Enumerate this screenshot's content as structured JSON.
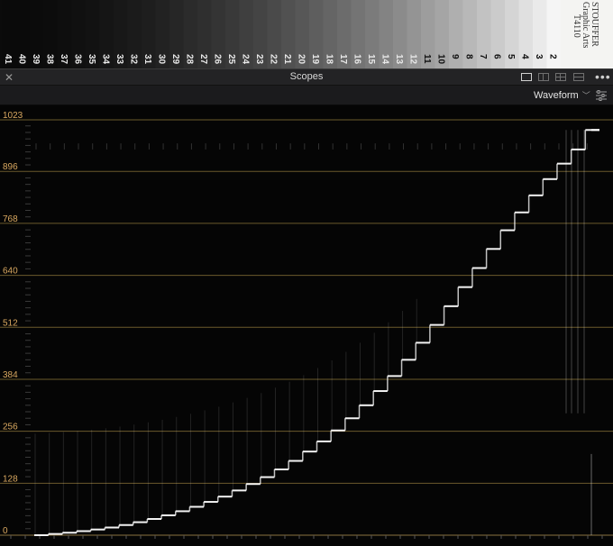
{
  "stepwedge": {
    "steps": [
      "41",
      "40",
      "39",
      "38",
      "37",
      "36",
      "35",
      "34",
      "33",
      "32",
      "31",
      "30",
      "29",
      "28",
      "27",
      "26",
      "25",
      "24",
      "23",
      "22",
      "21",
      "20",
      "19",
      "18",
      "17",
      "16",
      "15",
      "14",
      "13",
      "12",
      "11",
      "10",
      "9",
      "8",
      "7",
      "6",
      "5",
      "4",
      "3",
      "2"
    ],
    "brand_lines": [
      "STOUFFER",
      "Graphic Arts",
      "T4110"
    ]
  },
  "panel": {
    "title": "Scopes",
    "close_icon": "close-icon",
    "layout_icons": [
      "single-view-icon",
      "dual-view-icon",
      "quad-view-icon",
      "full-view-icon"
    ],
    "more_icon": "more-options-icon",
    "scope_type": "Waveform",
    "settings_icon": "scope-settings-icon"
  },
  "chart_data": {
    "type": "scatter",
    "title": "",
    "xlabel": "",
    "ylabel": "",
    "ylim": [
      0,
      1023
    ],
    "yticks": [
      0,
      128,
      256,
      384,
      512,
      640,
      768,
      896,
      1023
    ],
    "grid": true,
    "step_levels": [
      0,
      3,
      6,
      10,
      14,
      19,
      25,
      32,
      40,
      49,
      59,
      70,
      82,
      95,
      110,
      126,
      143,
      162,
      183,
      206,
      231,
      258,
      288,
      320,
      355,
      392,
      432,
      474,
      518,
      564,
      611,
      658,
      705,
      751,
      795,
      837,
      877,
      915,
      950,
      998
    ]
  },
  "colors": {
    "grid_line": "#6b5a2c",
    "tick_label": "#d9a860",
    "trace": "#ffffff",
    "background": "#050505"
  }
}
